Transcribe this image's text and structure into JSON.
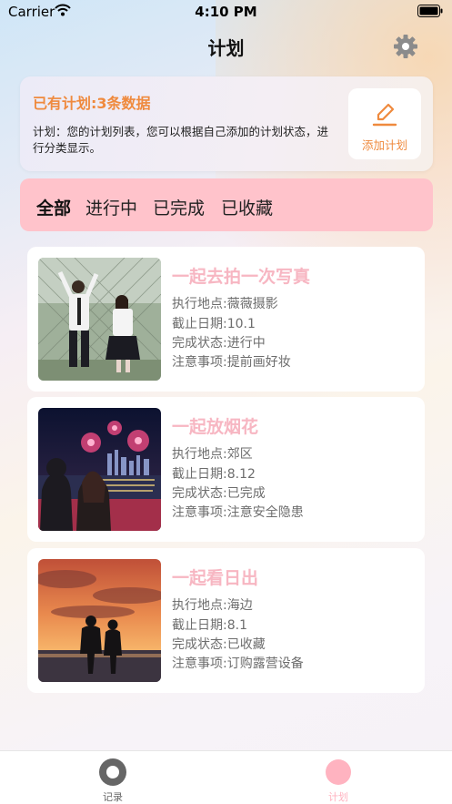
{
  "status_bar": {
    "carrier": "Carrier",
    "time": "4:10 PM"
  },
  "nav": {
    "title": "计划",
    "settings_icon": "gear-icon"
  },
  "summary": {
    "title": "已有计划:3条数据",
    "description": "计划：您的计划列表，您可以根据自己添加的计划状态，进行分类显示。",
    "add_button_label": "添加计划",
    "accent_color": "#ef8a3e"
  },
  "tabs": [
    {
      "label": "全部",
      "active": true
    },
    {
      "label": "进行中",
      "active": false
    },
    {
      "label": "已完成",
      "active": false
    },
    {
      "label": "已收藏",
      "active": false
    }
  ],
  "plans": [
    {
      "title": "一起去拍一次写真",
      "location": "执行地点:薇薇摄影",
      "deadline": "截止日期:10.1",
      "status": "完成状态:进行中",
      "note": "注意事项:提前画好妆"
    },
    {
      "title": "一起放烟花",
      "location": "执行地点:郊区",
      "deadline": "截止日期:8.12",
      "status": "完成状态:已完成",
      "note": "注意事项:注意安全隐患"
    },
    {
      "title": "一起看日出",
      "location": "执行地点:海边",
      "deadline": "截止日期:8.1",
      "status": "完成状态:已收藏",
      "note": "注意事项:订购露营设备"
    }
  ],
  "tabbar": [
    {
      "label": "记录",
      "icon": "record-icon",
      "active": false
    },
    {
      "label": "计划",
      "icon": "plan-icon",
      "active": true
    }
  ],
  "colors": {
    "tabs_bg": "#ffc3cb",
    "plan_title": "#f7b6c2",
    "tabbar_active": "#ffb3c0",
    "tabbar_inactive": "#666666"
  }
}
